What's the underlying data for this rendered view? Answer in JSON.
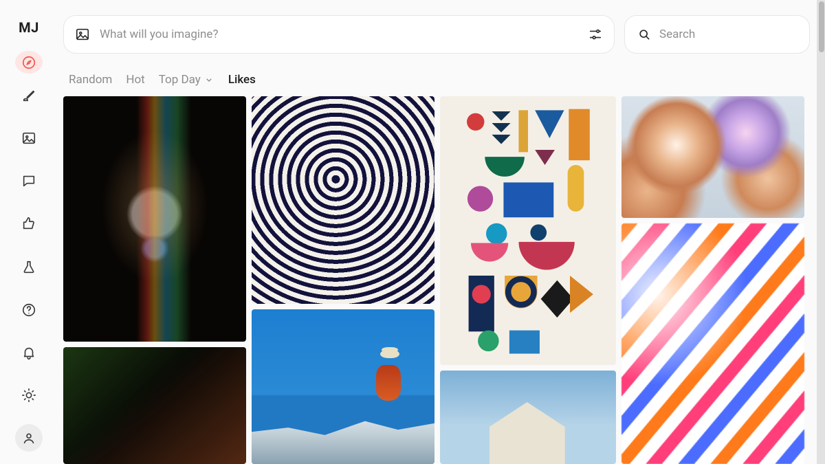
{
  "app": {
    "logo": "MJ"
  },
  "prompt": {
    "placeholder": "What will you imagine?"
  },
  "search": {
    "placeholder": "Search"
  },
  "tabs": {
    "random": "Random",
    "hot": "Hot",
    "top_day": "Top Day",
    "likes": "Likes",
    "active": "likes"
  },
  "sidebar": {
    "items": [
      {
        "name": "explore",
        "icon": "compass-icon",
        "active": true
      },
      {
        "name": "create",
        "icon": "brush-icon"
      },
      {
        "name": "gallery",
        "icon": "image-icon"
      },
      {
        "name": "chat",
        "icon": "chat-icon"
      },
      {
        "name": "likes",
        "icon": "thumbs-up-icon"
      }
    ],
    "footer": [
      {
        "name": "labs",
        "icon": "flask-icon"
      },
      {
        "name": "help",
        "icon": "help-icon"
      },
      {
        "name": "alerts",
        "icon": "bell-icon"
      },
      {
        "name": "theme",
        "icon": "sun-icon"
      },
      {
        "name": "account",
        "icon": "user-icon",
        "soft": true
      }
    ]
  },
  "gallery": {
    "columns": [
      [
        {
          "name": "painted-face-portrait"
        },
        {
          "name": "dark-botanical-abstract"
        }
      ],
      [
        {
          "name": "navy-zebra-pattern"
        },
        {
          "name": "monk-on-rock-blue-sky"
        }
      ],
      [
        {
          "name": "geometric-shapes-poster"
        },
        {
          "name": "house-sky-landscape"
        }
      ],
      [
        {
          "name": "iridescent-copper-blobs"
        },
        {
          "name": "neon-wave-stripes"
        }
      ]
    ]
  }
}
